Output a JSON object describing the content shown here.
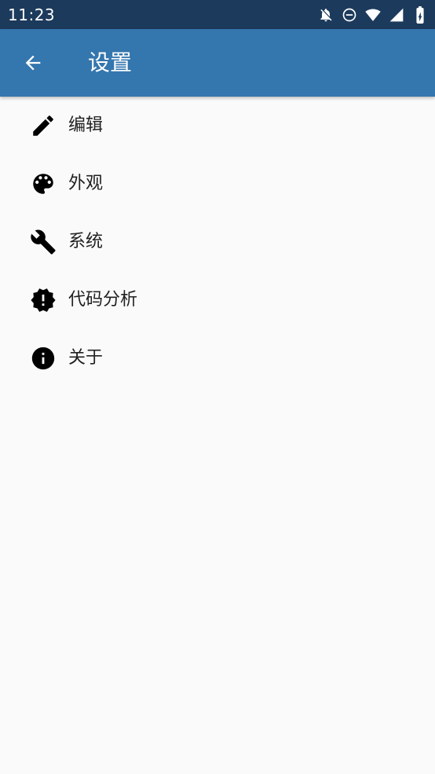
{
  "status_bar": {
    "time": "11:23",
    "icons": [
      "notifications-off-icon",
      "do-not-disturb-icon",
      "wifi-icon",
      "cell-signal-icon",
      "battery-charging-icon"
    ]
  },
  "app_bar": {
    "title": "设置",
    "back_icon": "arrow-back-icon",
    "color": "#3476AE"
  },
  "menu": {
    "items": [
      {
        "label": "编辑",
        "icon": "pencil-icon"
      },
      {
        "label": "外观",
        "icon": "palette-icon"
      },
      {
        "label": "系统",
        "icon": "wrench-icon"
      },
      {
        "label": "代码分析",
        "icon": "alert-badge-icon"
      },
      {
        "label": "关于",
        "icon": "info-icon"
      }
    ]
  },
  "colors": {
    "status_bar": "#1C3A5C",
    "background": "#FAFAFA",
    "text": "#212121"
  }
}
